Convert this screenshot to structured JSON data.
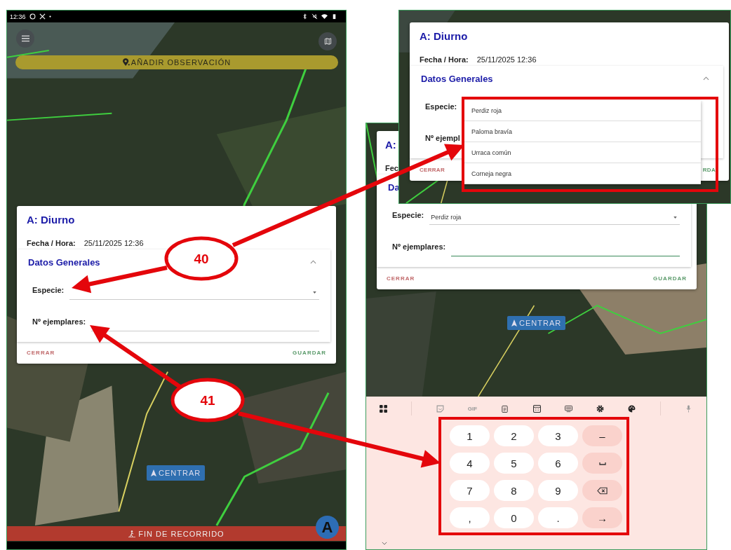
{
  "main_screen": {
    "status_bar": {
      "time": "12:36"
    },
    "add_button": "AÑADIR OBSERVACIÓN",
    "card": {
      "title": "A: Diurno",
      "date_label": "Fecha / Hora:",
      "date_value": "25/11/2025 12:36",
      "section": {
        "title": "Datos Generales",
        "expanded": true
      },
      "fields": [
        {
          "label": "Especie:",
          "kind": "select",
          "focused": false
        },
        {
          "label": "Nº ejemplares:",
          "kind": "number",
          "focused": false
        }
      ],
      "actions": [
        {
          "label": "CERRAR",
          "kind": "cancel"
        },
        {
          "label": "GUARDAR",
          "kind": "confirm"
        }
      ]
    },
    "center_button": "CENTRAR",
    "end_button": "FIN DE RECORRIDO",
    "user_badge": "A"
  },
  "keyboard_screen": {
    "card": {
      "title": "A:",
      "date_label": "Fec",
      "section": {
        "title": "Da"
      },
      "fields": [
        {
          "label": "Especie:",
          "kind": "select",
          "value": "Perdiz roja",
          "focused": false
        },
        {
          "label": "Nº ejemplares:",
          "kind": "number",
          "focused": true
        }
      ],
      "actions": [
        {
          "label": "CERRAR",
          "kind": "cancel"
        },
        {
          "label": "GUARDAR",
          "kind": "confirm"
        }
      ]
    },
    "center_button": "CENTRAR",
    "keyboard": {
      "toolbar_text": "GIF",
      "keys": [
        {
          "kind": "char",
          "label": "1"
        },
        {
          "kind": "char",
          "label": "2"
        },
        {
          "kind": "char",
          "label": "3"
        },
        {
          "kind": "action",
          "label": "–"
        },
        {
          "kind": "char",
          "label": "4"
        },
        {
          "kind": "char",
          "label": "5"
        },
        {
          "kind": "char",
          "label": "6"
        },
        {
          "kind": "space"
        },
        {
          "kind": "char",
          "label": "7"
        },
        {
          "kind": "char",
          "label": "8"
        },
        {
          "kind": "char",
          "label": "9"
        },
        {
          "kind": "backspace"
        },
        {
          "kind": "char",
          "label": ","
        },
        {
          "kind": "char",
          "label": "0"
        },
        {
          "kind": "char",
          "label": "."
        },
        {
          "kind": "action",
          "label": "→"
        }
      ]
    }
  },
  "dropdown_screen": {
    "card": {
      "title": "A: Diurno",
      "date_label": "Fecha / Hora:",
      "date_value": "25/11/2025 12:36",
      "section": {
        "title": "Datos Generales",
        "expanded": true
      },
      "fields": [
        {
          "label": "Especie:"
        },
        {
          "label": "Nº ejempl"
        }
      ],
      "actions": [
        {
          "label": "CERRAR",
          "kind": "cancel"
        },
        {
          "label": "RDA",
          "kind": "confirm"
        }
      ]
    },
    "options": [
      "Perdiz roja",
      "Paloma bravía",
      "Urraca común",
      "Corneja negra"
    ]
  },
  "callouts": [
    {
      "number": "40"
    },
    {
      "number": "41"
    }
  ]
}
